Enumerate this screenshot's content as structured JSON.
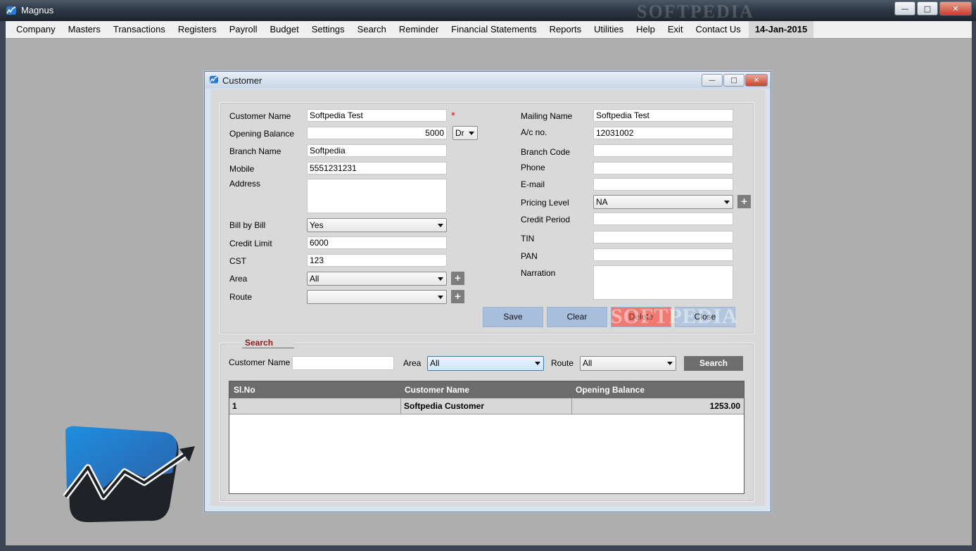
{
  "app": {
    "title": "Magnus",
    "watermark": "SOFTPEDIA"
  },
  "menu": {
    "items": [
      "Company",
      "Masters",
      "Transactions",
      "Registers",
      "Payroll",
      "Budget",
      "Settings",
      "Search",
      "Reminder",
      "Financial Statements",
      "Reports",
      "Utilities",
      "Help",
      "Exit",
      "Contact Us"
    ],
    "date": "14-Jan-2015"
  },
  "dialog": {
    "title": "Customer",
    "left": {
      "customer_name_label": "Customer Name",
      "customer_name_value": "Softpedia Test",
      "required_mark": "*",
      "opening_balance_label": "Opening Balance",
      "opening_balance_value": "5000",
      "dr_cr_value": "Dr",
      "branch_name_label": "Branch Name",
      "branch_name_value": "Softpedia",
      "mobile_label": "Mobile",
      "mobile_value": "5551231231",
      "address_label": "Address",
      "address_value": "",
      "bill_by_bill_label": "Bill by Bill",
      "bill_by_bill_value": "Yes",
      "credit_limit_label": "Credit Limit",
      "credit_limit_value": "6000",
      "cst_label": "CST",
      "cst_value": "123",
      "area_label": "Area",
      "area_value": "All",
      "route_label": "Route",
      "route_value": ""
    },
    "right": {
      "mailing_name_label": "Mailing Name",
      "mailing_name_value": "Softpedia Test",
      "ac_no_label": "A/c no.",
      "ac_no_value": "12031002",
      "branch_code_label": "Branch Code",
      "branch_code_value": "",
      "phone_label": "Phone",
      "phone_value": "",
      "email_label": "E-mail",
      "email_value": "",
      "pricing_level_label": "Pricing Level",
      "pricing_level_value": "NA",
      "credit_period_label": "Credit Period",
      "credit_period_value": "",
      "tin_label": "TIN",
      "tin_value": "",
      "pan_label": "PAN",
      "pan_value": "",
      "narration_label": "Narration",
      "narration_value": ""
    },
    "buttons": {
      "save": "Save",
      "clear": "Clear",
      "delete": "Delete",
      "close": "Close",
      "plus": "+"
    },
    "watermark": "SOFTPEDIA",
    "search": {
      "legend": "Search",
      "customer_name_label": "Customer Name",
      "customer_name_value": "",
      "area_label": "Area",
      "area_value": "All",
      "route_label": "Route",
      "route_value": "All",
      "search_button": "Search"
    },
    "grid": {
      "columns": [
        "Sl.No",
        "Customer Name",
        "Opening Balance"
      ],
      "rows": [
        {
          "sl_no": "1",
          "customer_name": "Softpedia Customer",
          "opening_balance": "1253.00"
        }
      ]
    }
  }
}
